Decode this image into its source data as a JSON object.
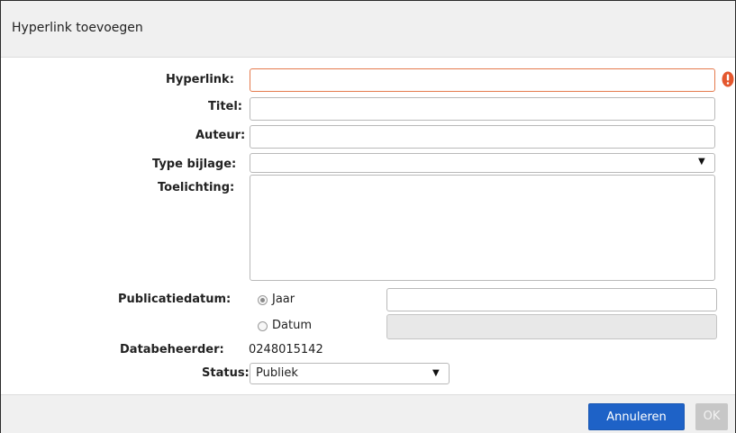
{
  "dialog": {
    "title": "Hyperlink toevoegen"
  },
  "form": {
    "hyperlink_label": "Hyperlink:",
    "titel_label": "Titel:",
    "auteur_label": "Auteur:",
    "type_bijlage_label": "Type bijlage:",
    "toelichting_label": "Toelichting:",
    "publicatiedatum_label": "Publicatiedatum:",
    "jaar_label": "Jaar",
    "datum_label": "Datum",
    "databeheerder_label": "Databeheerder:",
    "databeheerder_value": "0248015142",
    "status_label": "Status:",
    "status_value": "Publiek",
    "selected_publication_option": "Jaar"
  },
  "footer": {
    "cancel_label": "Annuleren",
    "ok_label": "OK"
  },
  "colors": {
    "error_border": "#e57a4d",
    "warning_icon": "#e4572e",
    "primary_button": "#1e62c7",
    "disabled_button": "#c7c7c7"
  },
  "icons": {
    "warning": "warning-icon",
    "dropdown": "chevron-down-icon"
  }
}
